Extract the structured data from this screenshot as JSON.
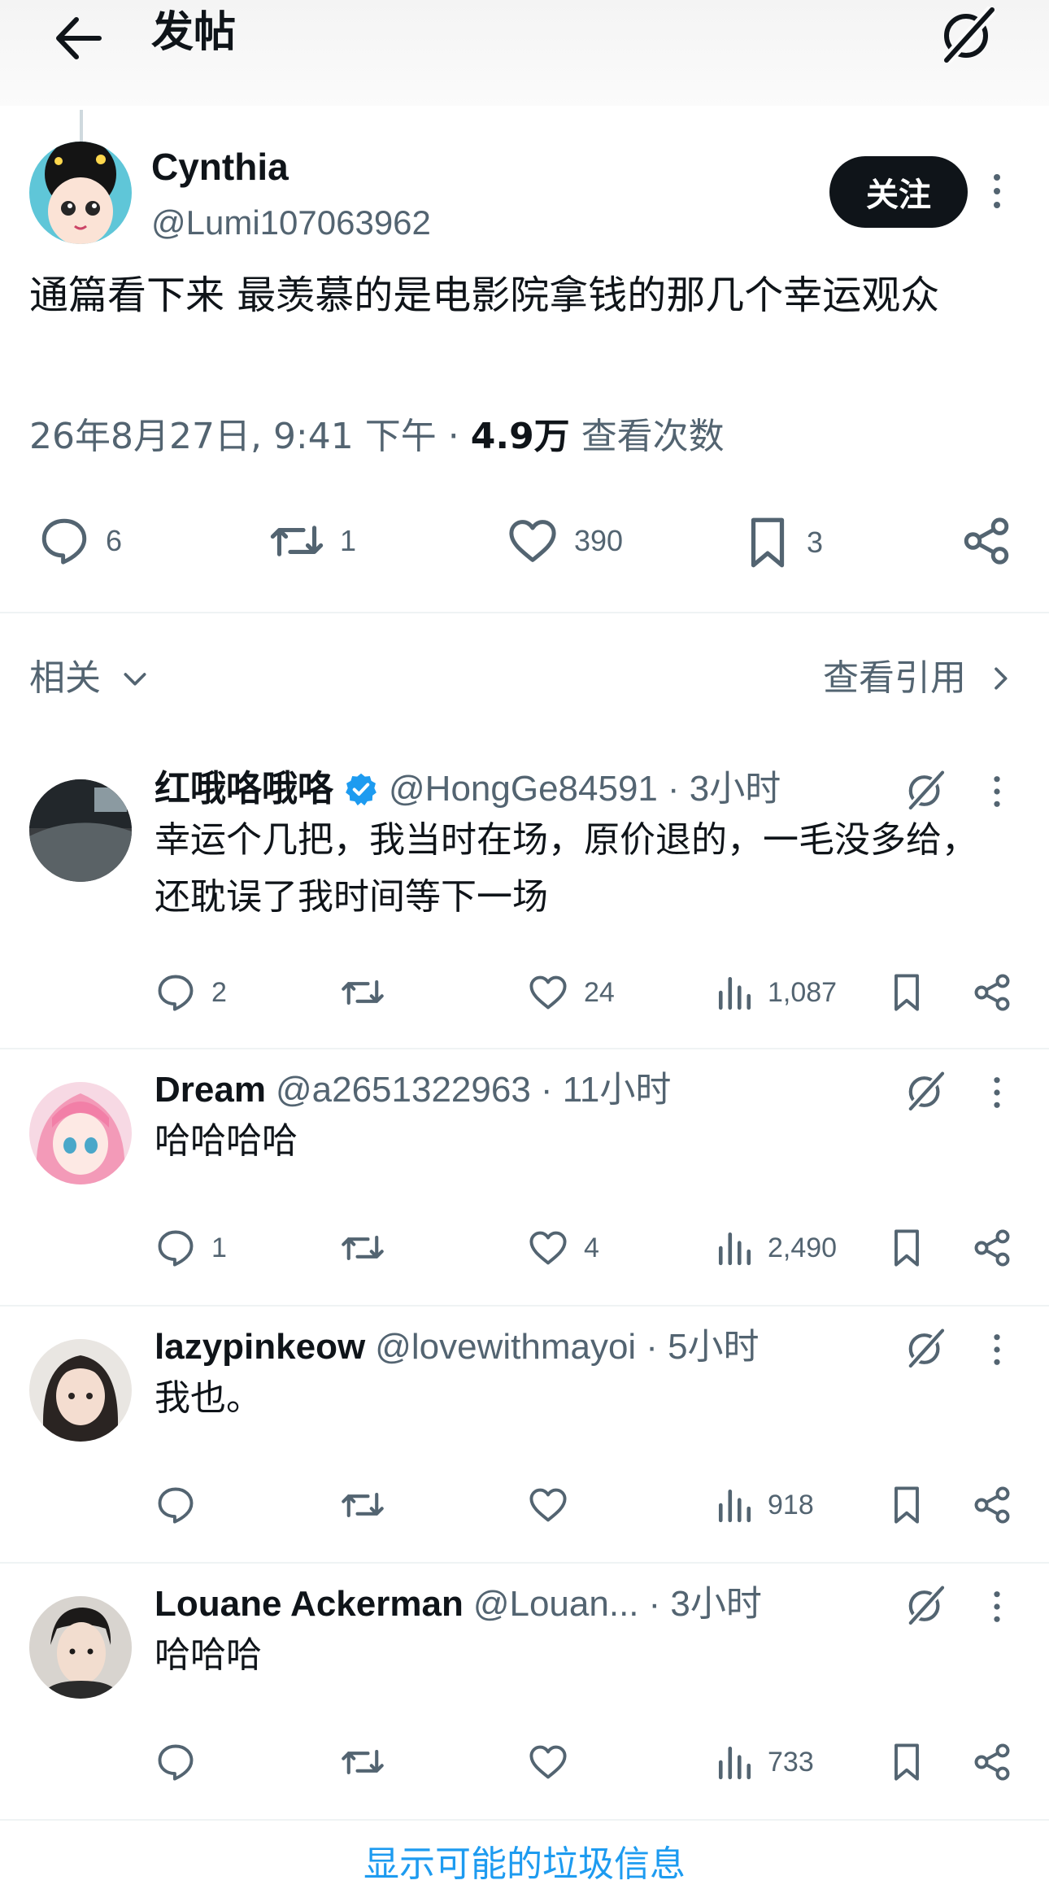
{
  "header": {
    "title": "发帖"
  },
  "post": {
    "author_name": "Cynthia",
    "author_handle": "@Lumi107063962",
    "follow_label": "关注",
    "text": "通篇看下来 最羡慕的是电影院拿钱的那几个幸运观众",
    "timestamp": "26年8月27日, 9:41 下午",
    "views_count": "4.9万",
    "views_label": "查看次数",
    "stats": {
      "replies": "6",
      "reposts": "1",
      "likes": "390",
      "bookmarks": "3"
    }
  },
  "related": {
    "label": "相关",
    "quotes_label": "查看引用"
  },
  "replies": [
    {
      "name": "红哦咯哦咯",
      "verified": true,
      "handle": "@HongGe84591",
      "time": "· 3小时",
      "text": "幸运个几把，我当时在场，原价退的，一毛没多给，还耽误了我时间等下一场",
      "replies": "2",
      "reposts": "",
      "likes": "24",
      "views": "1,087"
    },
    {
      "name": "Dream",
      "verified": false,
      "handle": "@a2651322963",
      "time": "· 11小时",
      "text": "哈哈哈哈",
      "replies": "1",
      "reposts": "",
      "likes": "4",
      "views": "2,490"
    },
    {
      "name": "lazypinkeow",
      "verified": false,
      "handle": "@lovewithmayoi",
      "time": "· 5小时",
      "text": "我也。",
      "replies": "",
      "reposts": "",
      "likes": "",
      "views": "918"
    },
    {
      "name": "Louane Ackerman",
      "verified": false,
      "handle": "@Louan...",
      "time": "· 3小时",
      "text": "哈哈哈",
      "replies": "",
      "reposts": "",
      "likes": "",
      "views": "733"
    }
  ],
  "spam_link": "显示可能的垃圾信息"
}
